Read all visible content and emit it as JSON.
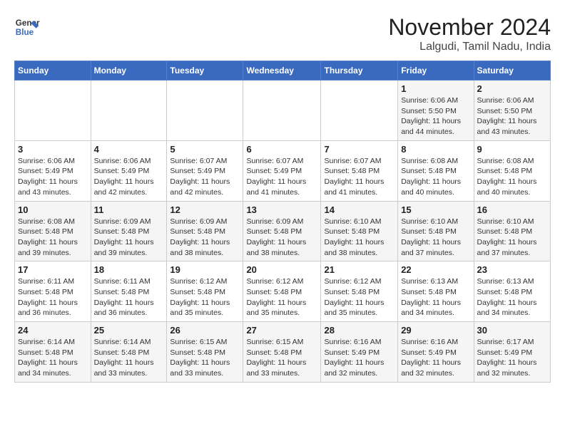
{
  "logo": {
    "line1": "General",
    "line2": "Blue"
  },
  "title": "November 2024",
  "location": "Lalgudi, Tamil Nadu, India",
  "weekdays": [
    "Sunday",
    "Monday",
    "Tuesday",
    "Wednesday",
    "Thursday",
    "Friday",
    "Saturday"
  ],
  "weeks": [
    [
      {
        "day": "",
        "info": ""
      },
      {
        "day": "",
        "info": ""
      },
      {
        "day": "",
        "info": ""
      },
      {
        "day": "",
        "info": ""
      },
      {
        "day": "",
        "info": ""
      },
      {
        "day": "1",
        "info": "Sunrise: 6:06 AM\nSunset: 5:50 PM\nDaylight: 11 hours and 44 minutes."
      },
      {
        "day": "2",
        "info": "Sunrise: 6:06 AM\nSunset: 5:50 PM\nDaylight: 11 hours and 43 minutes."
      }
    ],
    [
      {
        "day": "3",
        "info": "Sunrise: 6:06 AM\nSunset: 5:49 PM\nDaylight: 11 hours and 43 minutes."
      },
      {
        "day": "4",
        "info": "Sunrise: 6:06 AM\nSunset: 5:49 PM\nDaylight: 11 hours and 42 minutes."
      },
      {
        "day": "5",
        "info": "Sunrise: 6:07 AM\nSunset: 5:49 PM\nDaylight: 11 hours and 42 minutes."
      },
      {
        "day": "6",
        "info": "Sunrise: 6:07 AM\nSunset: 5:49 PM\nDaylight: 11 hours and 41 minutes."
      },
      {
        "day": "7",
        "info": "Sunrise: 6:07 AM\nSunset: 5:48 PM\nDaylight: 11 hours and 41 minutes."
      },
      {
        "day": "8",
        "info": "Sunrise: 6:08 AM\nSunset: 5:48 PM\nDaylight: 11 hours and 40 minutes."
      },
      {
        "day": "9",
        "info": "Sunrise: 6:08 AM\nSunset: 5:48 PM\nDaylight: 11 hours and 40 minutes."
      }
    ],
    [
      {
        "day": "10",
        "info": "Sunrise: 6:08 AM\nSunset: 5:48 PM\nDaylight: 11 hours and 39 minutes."
      },
      {
        "day": "11",
        "info": "Sunrise: 6:09 AM\nSunset: 5:48 PM\nDaylight: 11 hours and 39 minutes."
      },
      {
        "day": "12",
        "info": "Sunrise: 6:09 AM\nSunset: 5:48 PM\nDaylight: 11 hours and 38 minutes."
      },
      {
        "day": "13",
        "info": "Sunrise: 6:09 AM\nSunset: 5:48 PM\nDaylight: 11 hours and 38 minutes."
      },
      {
        "day": "14",
        "info": "Sunrise: 6:10 AM\nSunset: 5:48 PM\nDaylight: 11 hours and 38 minutes."
      },
      {
        "day": "15",
        "info": "Sunrise: 6:10 AM\nSunset: 5:48 PM\nDaylight: 11 hours and 37 minutes."
      },
      {
        "day": "16",
        "info": "Sunrise: 6:10 AM\nSunset: 5:48 PM\nDaylight: 11 hours and 37 minutes."
      }
    ],
    [
      {
        "day": "17",
        "info": "Sunrise: 6:11 AM\nSunset: 5:48 PM\nDaylight: 11 hours and 36 minutes."
      },
      {
        "day": "18",
        "info": "Sunrise: 6:11 AM\nSunset: 5:48 PM\nDaylight: 11 hours and 36 minutes."
      },
      {
        "day": "19",
        "info": "Sunrise: 6:12 AM\nSunset: 5:48 PM\nDaylight: 11 hours and 35 minutes."
      },
      {
        "day": "20",
        "info": "Sunrise: 6:12 AM\nSunset: 5:48 PM\nDaylight: 11 hours and 35 minutes."
      },
      {
        "day": "21",
        "info": "Sunrise: 6:12 AM\nSunset: 5:48 PM\nDaylight: 11 hours and 35 minutes."
      },
      {
        "day": "22",
        "info": "Sunrise: 6:13 AM\nSunset: 5:48 PM\nDaylight: 11 hours and 34 minutes."
      },
      {
        "day": "23",
        "info": "Sunrise: 6:13 AM\nSunset: 5:48 PM\nDaylight: 11 hours and 34 minutes."
      }
    ],
    [
      {
        "day": "24",
        "info": "Sunrise: 6:14 AM\nSunset: 5:48 PM\nDaylight: 11 hours and 34 minutes."
      },
      {
        "day": "25",
        "info": "Sunrise: 6:14 AM\nSunset: 5:48 PM\nDaylight: 11 hours and 33 minutes."
      },
      {
        "day": "26",
        "info": "Sunrise: 6:15 AM\nSunset: 5:48 PM\nDaylight: 11 hours and 33 minutes."
      },
      {
        "day": "27",
        "info": "Sunrise: 6:15 AM\nSunset: 5:48 PM\nDaylight: 11 hours and 33 minutes."
      },
      {
        "day": "28",
        "info": "Sunrise: 6:16 AM\nSunset: 5:49 PM\nDaylight: 11 hours and 32 minutes."
      },
      {
        "day": "29",
        "info": "Sunrise: 6:16 AM\nSunset: 5:49 PM\nDaylight: 11 hours and 32 minutes."
      },
      {
        "day": "30",
        "info": "Sunrise: 6:17 AM\nSunset: 5:49 PM\nDaylight: 11 hours and 32 minutes."
      }
    ]
  ]
}
